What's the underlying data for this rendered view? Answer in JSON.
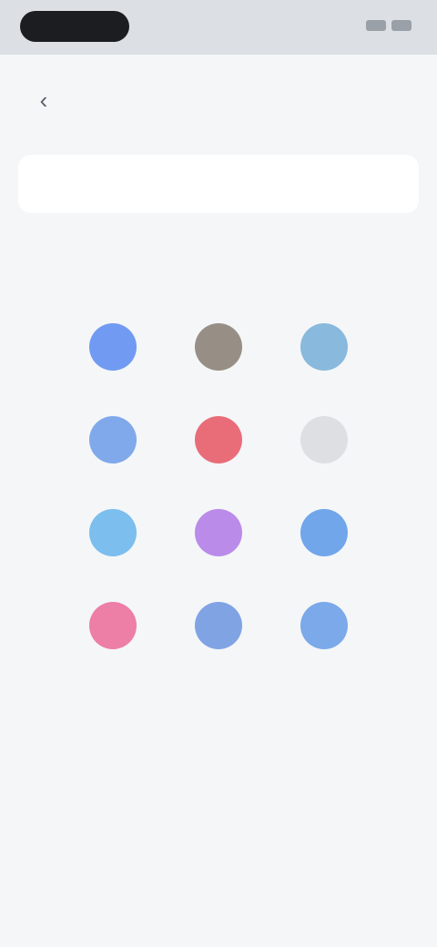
{
  "status_bar": {
    "time": ""
  },
  "nav": {
    "back_icon": "chevron-left-icon",
    "title": "",
    "action_label": ""
  },
  "search": {
    "value": "",
    "placeholder": ""
  },
  "description": "",
  "apps": [
    {
      "label": "",
      "color": "#5f8df0",
      "icon": "app-icon"
    },
    {
      "label": "",
      "color": "#8a8174",
      "icon": "app-icon"
    },
    {
      "label": "",
      "color": "#7ab0d8",
      "icon": "app-icon"
    },
    {
      "label": "",
      "color": "#6f9ee8",
      "icon": "app-icon"
    },
    {
      "label": "",
      "color": "#e75a66",
      "icon": "app-icon"
    },
    {
      "label": "",
      "color": "#d9dcdf",
      "icon": "app-icon"
    },
    {
      "label": "",
      "color": "#6bb6ec",
      "icon": "app-icon"
    },
    {
      "label": "",
      "color": "#b27ce6",
      "icon": "app-icon"
    },
    {
      "label": "",
      "color": "#5f9be8",
      "icon": "app-icon"
    },
    {
      "label": "",
      "color": "#ec6d9a",
      "icon": "app-icon"
    },
    {
      "label": "",
      "color": "#6f97e0",
      "icon": "app-icon"
    },
    {
      "label": "",
      "color": "#6a9ee6",
      "icon": "app-icon"
    }
  ]
}
